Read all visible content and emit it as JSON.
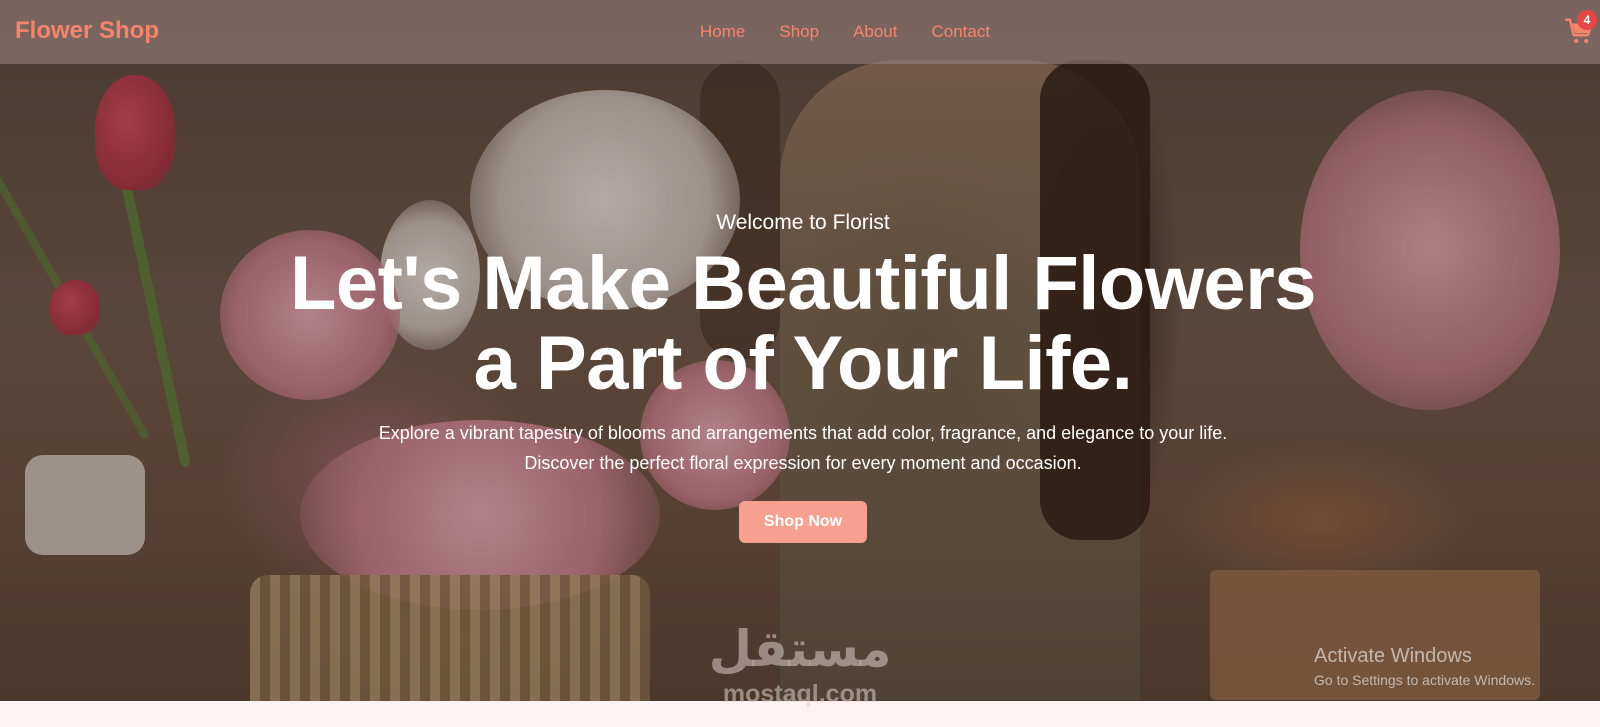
{
  "navbar": {
    "brand": "Flower Shop",
    "links": [
      "Home",
      "Shop",
      "About",
      "Contact"
    ],
    "cart_count": "4",
    "cart_icon": "shopping-cart-icon"
  },
  "hero": {
    "welcome": "Welcome to Florist",
    "headline_line1": "Let's Make Beautiful Flowers",
    "headline_line2": "a Part of Your Life.",
    "description_line1": "Explore a vibrant tapestry of blooms and arrangements that add color, fragrance, and elegance to your life.",
    "description_line2": "Discover the perfect floral expression for every moment and occasion.",
    "cta": "Shop Now"
  },
  "watermark": {
    "arabic": "مستقل",
    "latin": "mostaql.com"
  },
  "os_overlay": {
    "title": "Activate Windows",
    "subtitle": "Go to Settings to activate Windows."
  },
  "colors": {
    "accent": "#f6846c",
    "button": "#f8a090",
    "badge": "#e64545",
    "page_bg": "#fdf3f2"
  }
}
